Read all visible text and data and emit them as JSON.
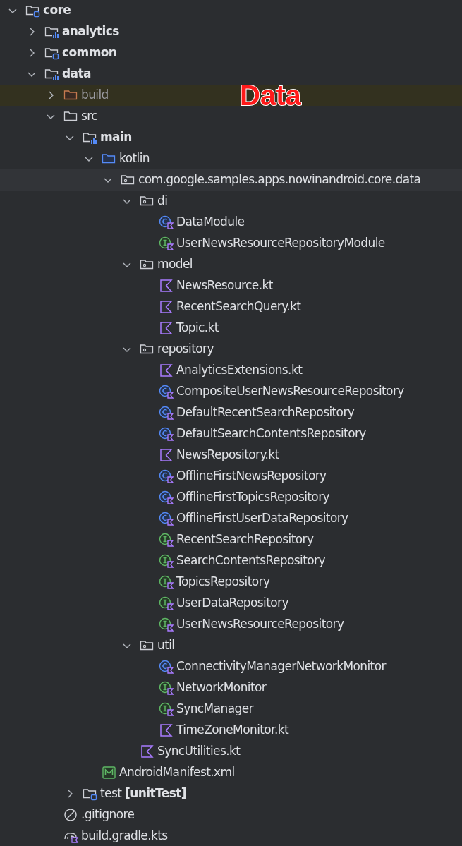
{
  "tree": [
    {
      "name": "core",
      "kind": "module",
      "bold": true,
      "expanded": true,
      "selected": false,
      "children": [
        {
          "name": "analytics",
          "kind": "module_chart",
          "bold": true,
          "expanded": false,
          "selected": false
        },
        {
          "name": "common",
          "kind": "module",
          "bold": true,
          "expanded": false,
          "selected": false
        },
        {
          "name": "data",
          "kind": "module_chart",
          "bold": true,
          "expanded": true,
          "selected": false,
          "children": [
            {
              "name": "build",
              "kind": "excluded_folder",
              "bold": false,
              "expanded": false,
              "selected": false,
              "annotation": "Data"
            },
            {
              "name": "src",
              "kind": "folder",
              "bold": false,
              "expanded": true,
              "selected": false,
              "children": [
                {
                  "name": "main",
                  "kind": "module_chart",
                  "bold": true,
                  "expanded": true,
                  "selected": false,
                  "children": [
                    {
                      "name": "kotlin",
                      "kind": "source_root",
                      "bold": false,
                      "expanded": true,
                      "selected": false,
                      "children": [
                        {
                          "name": "com.google.samples.apps.nowinandroid.core.data",
                          "kind": "package",
                          "bold": false,
                          "expanded": true,
                          "selected": true,
                          "children": [
                            {
                              "name": "di",
                              "kind": "package",
                              "bold": false,
                              "expanded": true,
                              "selected": false,
                              "children": [
                                {
                                  "name": "DataModule",
                                  "kind": "class",
                                  "bold": false,
                                  "selected": false
                                },
                                {
                                  "name": "UserNewsResourceRepositoryModule",
                                  "kind": "interface",
                                  "bold": false,
                                  "selected": false
                                }
                              ]
                            },
                            {
                              "name": "model",
                              "kind": "package",
                              "bold": false,
                              "expanded": true,
                              "selected": false,
                              "children": [
                                {
                                  "name": "NewsResource.kt",
                                  "kind": "kotlin_file",
                                  "bold": false,
                                  "selected": false
                                },
                                {
                                  "name": "RecentSearchQuery.kt",
                                  "kind": "kotlin_file",
                                  "bold": false,
                                  "selected": false
                                },
                                {
                                  "name": "Topic.kt",
                                  "kind": "kotlin_file",
                                  "bold": false,
                                  "selected": false
                                }
                              ]
                            },
                            {
                              "name": "repository",
                              "kind": "package",
                              "bold": false,
                              "expanded": true,
                              "selected": false,
                              "children": [
                                {
                                  "name": "AnalyticsExtensions.kt",
                                  "kind": "kotlin_file",
                                  "bold": false,
                                  "selected": false
                                },
                                {
                                  "name": "CompositeUserNewsResourceRepository",
                                  "kind": "class",
                                  "bold": false,
                                  "selected": false
                                },
                                {
                                  "name": "DefaultRecentSearchRepository",
                                  "kind": "class",
                                  "bold": false,
                                  "selected": false
                                },
                                {
                                  "name": "DefaultSearchContentsRepository",
                                  "kind": "class",
                                  "bold": false,
                                  "selected": false
                                },
                                {
                                  "name": "NewsRepository.kt",
                                  "kind": "kotlin_file",
                                  "bold": false,
                                  "selected": false
                                },
                                {
                                  "name": "OfflineFirstNewsRepository",
                                  "kind": "class",
                                  "bold": false,
                                  "selected": false
                                },
                                {
                                  "name": "OfflineFirstTopicsRepository",
                                  "kind": "class",
                                  "bold": false,
                                  "selected": false
                                },
                                {
                                  "name": "OfflineFirstUserDataRepository",
                                  "kind": "class",
                                  "bold": false,
                                  "selected": false
                                },
                                {
                                  "name": "RecentSearchRepository",
                                  "kind": "interface",
                                  "bold": false,
                                  "selected": false
                                },
                                {
                                  "name": "SearchContentsRepository",
                                  "kind": "interface",
                                  "bold": false,
                                  "selected": false
                                },
                                {
                                  "name": "TopicsRepository",
                                  "kind": "interface",
                                  "bold": false,
                                  "selected": false
                                },
                                {
                                  "name": "UserDataRepository",
                                  "kind": "interface",
                                  "bold": false,
                                  "selected": false
                                },
                                {
                                  "name": "UserNewsResourceRepository",
                                  "kind": "interface",
                                  "bold": false,
                                  "selected": false
                                }
                              ]
                            },
                            {
                              "name": "util",
                              "kind": "package",
                              "bold": false,
                              "expanded": true,
                              "selected": false,
                              "children": [
                                {
                                  "name": "ConnectivityManagerNetworkMonitor",
                                  "kind": "class",
                                  "bold": false,
                                  "selected": false
                                },
                                {
                                  "name": "NetworkMonitor",
                                  "kind": "interface",
                                  "bold": false,
                                  "selected": false
                                },
                                {
                                  "name": "SyncManager",
                                  "kind": "interface",
                                  "bold": false,
                                  "selected": false
                                },
                                {
                                  "name": "TimeZoneMonitor.kt",
                                  "kind": "kotlin_file",
                                  "bold": false,
                                  "selected": false
                                }
                              ]
                            },
                            {
                              "name": "SyncUtilities.kt",
                              "kind": "kotlin_file",
                              "bold": false,
                              "selected": false
                            }
                          ]
                        }
                      ]
                    },
                    {
                      "name": "AndroidManifest.xml",
                      "kind": "manifest",
                      "bold": false,
                      "selected": false
                    }
                  ]
                },
                {
                  "name": "test **[unitTest]**",
                  "kind": "module",
                  "bold": false,
                  "expanded": false,
                  "selected": false
                }
              ]
            },
            {
              "name": ".gitignore",
              "kind": "ignore",
              "bold": false,
              "selected": false
            },
            {
              "name": "build.gradle.kts",
              "kind": "gradle",
              "bold": false,
              "selected": false
            }
          ]
        }
      ]
    }
  ]
}
